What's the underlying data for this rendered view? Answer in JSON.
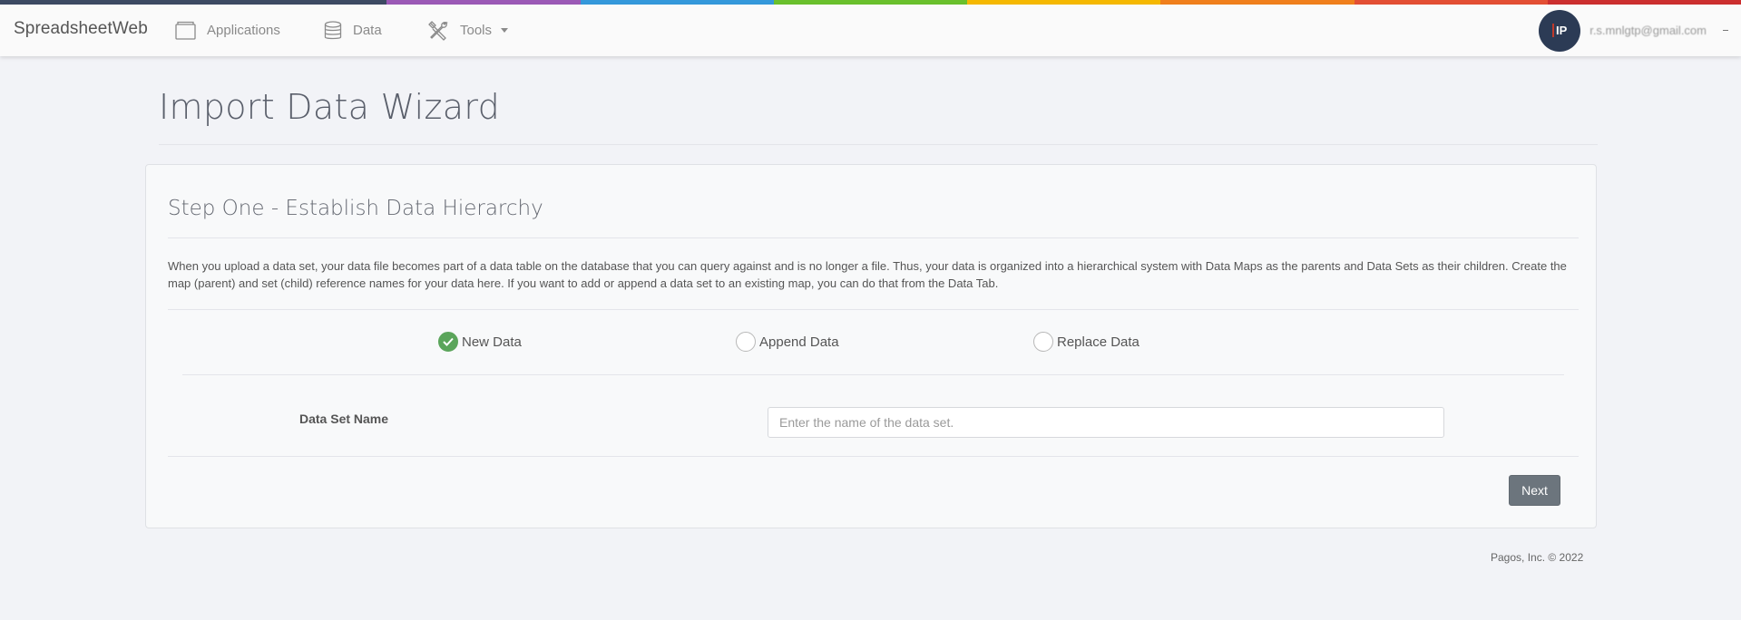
{
  "colors": {
    "stripe": [
      "#3d4a63",
      "#9b59b6",
      "#3498db",
      "#6ac02c",
      "#f5b800",
      "#f07f1c",
      "#e34f34",
      "#cc2f2f"
    ],
    "accent_success": "#5ba55b",
    "button_secondary": "#6c757d"
  },
  "navbar": {
    "brand": "SpreadsheetWeb",
    "items": [
      {
        "label": "Applications",
        "icon": "applications-icon"
      },
      {
        "label": "Data",
        "icon": "database-icon"
      },
      {
        "label": "Tools",
        "icon": "tools-icon"
      }
    ],
    "user": {
      "initials": "IP",
      "email": "r.s.mnlgtp@gmail.com"
    }
  },
  "page": {
    "title": "Import Data Wizard"
  },
  "wizard": {
    "step_title": "Step One - Establish Data Hierarchy",
    "description": "When you upload a data set, your data file becomes part of a data table on the database that you can query against and is no longer a file. Thus, your data is organized into a hierarchical system with Data Maps as the parents and Data Sets as their children. Create the map (parent) and set (child) reference names for your data here. If you want to add or append a data set to an existing map, you can do that from the Data Tab.",
    "options": [
      {
        "label": "New Data",
        "checked": true
      },
      {
        "label": "Append Data",
        "checked": false
      },
      {
        "label": "Replace Data",
        "checked": false
      }
    ],
    "field": {
      "label": "Data Set Name",
      "value": "",
      "placeholder": "Enter the name of the data set."
    },
    "next_label": "Next"
  },
  "footer": {
    "text": "Pagos, Inc. © 2022"
  }
}
